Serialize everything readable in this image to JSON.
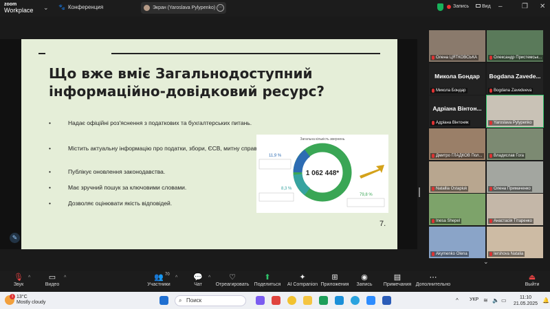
{
  "app": {
    "logo_line1": "zoom",
    "logo_line2": "Workplace",
    "conference_label": "Конференция"
  },
  "screen_share": {
    "label": "Экран (Yaroslava Pylypenko)"
  },
  "top_right": {
    "record_label": "Запись",
    "view_label": "Вид"
  },
  "slide": {
    "title": "Що вже вміє Загальнодоступний інформаційно-довідковий ресурс?",
    "bullets": [
      "Надає офіційні роз'яснення з податкових та бухгалтерських питань.",
      "Містить актуальну інформацію про податки, збори, ЄСВ, митну справу.",
      "Публікує оновлення законодавства.",
      "Має зручний пошук за ключовими словами.",
      "Дозволяє оцінювати якість відповідей."
    ],
    "bullet_mark": "•",
    "number": "7.",
    "infographic": {
      "heading": "Загальна кількість звернень",
      "total": "1 062 448*",
      "pct_top": "11,9 %",
      "pct_mid": "8,3 %",
      "pct_right": "79,8 %",
      "colors": {
        "green": "#3aa655",
        "blue": "#2d6cb3",
        "teal": "#36a3a0",
        "arrow": "#d4a21a"
      }
    }
  },
  "gallery": {
    "tiles": [
      {
        "name": "Олена ЦЯТКОВСЬКА",
        "big": "",
        "photo": "#8a7a6c",
        "active": false
      },
      {
        "name": "Олександр Пристемськ...",
        "big": "",
        "photo": "#5a7a5a",
        "active": false
      },
      {
        "name": "Микола Бондар",
        "big": "Микола Бондар",
        "photo": "#222222",
        "active": false
      },
      {
        "name": "Bogdana Zavedeeva",
        "big": "Bogdana Zavede...",
        "photo": "#222222",
        "active": false
      },
      {
        "name": "Адріана Вінтоняк",
        "big": "Адріана Вінтон...",
        "photo": "#222222",
        "active": false
      },
      {
        "name": "Yaroslava Pylypenko",
        "big": "",
        "photo": "#c9c2b6",
        "active": true
      },
      {
        "name": "Дмитро ГЛАДКОВ Пол...",
        "big": "",
        "photo": "#9a7f68",
        "active": false
      },
      {
        "name": "Владислав Гога",
        "big": "",
        "photo": "#7c8a72",
        "active": false
      },
      {
        "name": "Natallia Ostapiuk",
        "big": "",
        "photo": "#b8a68f",
        "active": false
      },
      {
        "name": "Олена Примаченко",
        "big": "",
        "photo": "#a3a6a0",
        "active": false
      },
      {
        "name": "Inesa Shepel",
        "big": "",
        "photo": "#7da36a",
        "active": false
      },
      {
        "name": "Анастасія Тітаренко",
        "big": "",
        "photo": "#c4b7a8",
        "active": false
      },
      {
        "name": "Akymenko Olena",
        "big": "",
        "photo": "#8aa4c8",
        "active": false
      },
      {
        "name": "Iershova Natalia",
        "big": "",
        "photo": "#cdbba4",
        "active": false
      }
    ]
  },
  "toolbar": {
    "audio": "Звук",
    "video": "Видео",
    "participants": "Участники",
    "participants_count": "70",
    "chat": "Чат",
    "react": "Отреагировать",
    "share": "Поделиться",
    "ai": "AI Companion",
    "apps": "Приложения",
    "record": "Запись",
    "notes": "Примечания",
    "more": "Дополнительно",
    "leave": "Выйти"
  },
  "taskbar": {
    "temperature": "13°C",
    "weather": "Mostly cloudy",
    "badge": "1",
    "search_placeholder": "Поиск",
    "lang": "УКР",
    "time": "11:10",
    "date": "21.05.2025"
  }
}
